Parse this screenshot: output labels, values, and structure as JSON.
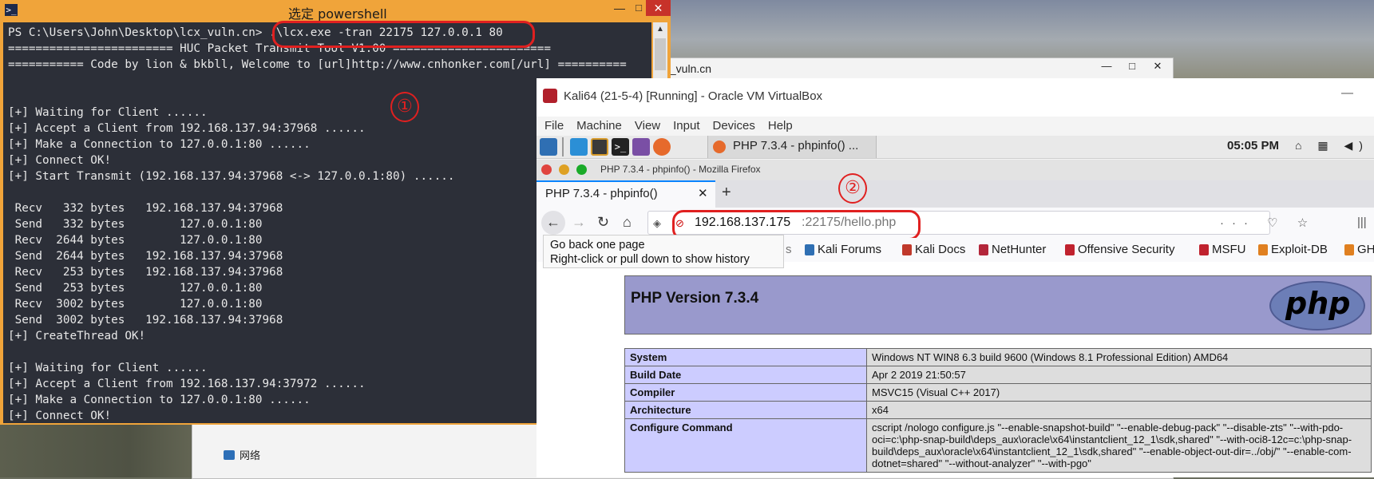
{
  "powershell": {
    "title": "选定 powershell",
    "icon": "powershell-icon",
    "min": "—",
    "max": "□",
    "close": "✕",
    "lines": [
      "PS C:\\Users\\John\\Desktop\\lcx_vuln.cn> .\\lcx.exe -tran 22175 127.0.0.1 80",
      "======================== HUC Packet Transmit Tool V1.00 =======================",
      "=========== Code by lion & bkbll, Welcome to [url]http://www.cnhonker.com[/url] ==========",
      "",
      "",
      "[+] Waiting for Client ......",
      "[+] Accept a Client from 192.168.137.94:37968 ......",
      "[+] Make a Connection to 127.0.0.1:80 ......",
      "[+] Connect OK!",
      "[+] Start Transmit (192.168.137.94:37968 <-> 127.0.0.1:80) ......",
      "",
      " Recv   332 bytes   192.168.137.94:37968",
      " Send   332 bytes        127.0.0.1:80",
      " Recv  2644 bytes        127.0.0.1:80",
      " Send  2644 bytes   192.168.137.94:37968",
      " Recv   253 bytes   192.168.137.94:37968",
      " Send   253 bytes        127.0.0.1:80",
      " Recv  3002 bytes        127.0.0.1:80",
      " Send  3002 bytes   192.168.137.94:37968",
      "[+] CreateThread OK!",
      "",
      "[+] Waiting for Client ......",
      "[+] Accept a Client from 192.168.137.94:37972 ......",
      "[+] Make a Connection to 127.0.0.1:80 ......",
      "[+] Connect OK!"
    ]
  },
  "annotations": {
    "one": "①",
    "two": "②"
  },
  "explorer": {
    "title": "t_vuln.cn",
    "min": "—",
    "max": "□",
    "close": "✕",
    "nav_item": "网络"
  },
  "vbox": {
    "title": "Kali64 (21-5-4) [Running] - Oracle VM VirtualBox",
    "min": "—",
    "menu": [
      "File",
      "Machine",
      "View",
      "Input",
      "Devices",
      "Help"
    ]
  },
  "kali": {
    "task_label": "PHP 7.3.4 - phpinfo() ...",
    "time": "05:05 PM",
    "tray": "⌂ ▦ ◀)"
  },
  "firefox": {
    "window_title": "PHP 7.3.4 - phpinfo() - Mozilla Firefox",
    "tab_label": "PHP 7.3.4 - phpinfo()",
    "tab_close": "✕",
    "new_tab": "+",
    "url_host": "192.168.137.175",
    "url_rest": ":22175/hello.php",
    "url_actions": "··· ♡ ☆",
    "tooltip_line1": "Go back one page",
    "tooltip_line2": "Right-click or pull down to show history",
    "bookmarks": [
      "Kali Forums",
      "Kali Docs",
      "NetHunter",
      "Offensive Security",
      "MSFU",
      "Exploit-DB",
      "GH"
    ],
    "bookmark_partial": "s"
  },
  "php": {
    "version": "PHP Version 7.3.4",
    "logo": "php",
    "rows": [
      {
        "key": "System",
        "value": "Windows NT WIN8 6.3 build 9600 (Windows 8.1 Professional Edition) AMD64"
      },
      {
        "key": "Build Date",
        "value": "Apr 2 2019 21:50:57"
      },
      {
        "key": "Compiler",
        "value": "MSVC15 (Visual C++ 2017)"
      },
      {
        "key": "Architecture",
        "value": "x64"
      },
      {
        "key": "Configure Command",
        "value": "cscript /nologo configure.js \"--enable-snapshot-build\" \"--enable-debug-pack\" \"--disable-zts\" \"--with-pdo-oci=c:\\php-snap-build\\deps_aux\\oracle\\x64\\instantclient_12_1\\sdk,shared\" \"--with-oci8-12c=c:\\php-snap-build\\deps_aux\\oracle\\x64\\instantclient_12_1\\sdk,shared\" \"--enable-object-out-dir=../obj/\" \"--enable-com-dotnet=shared\" \"--without-analyzer\" \"--with-pgo\""
      }
    ]
  }
}
